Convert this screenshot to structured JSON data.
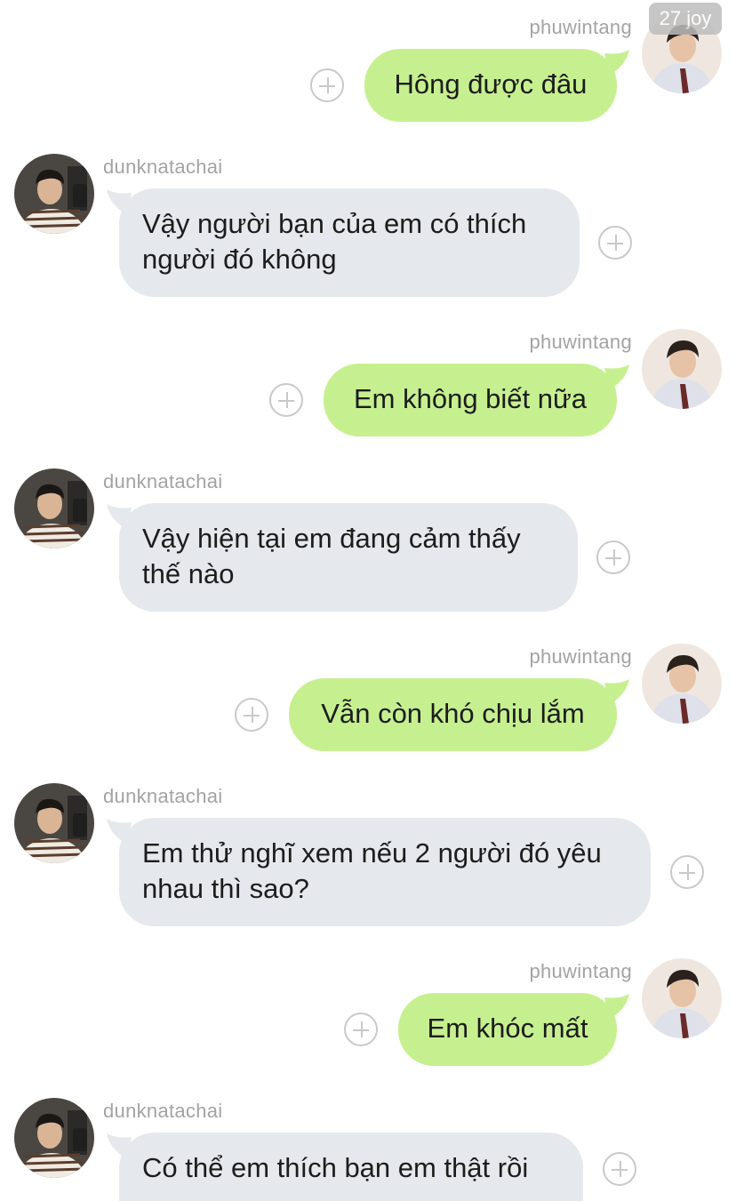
{
  "watermark": "27 joy",
  "messages": [
    {
      "sender": "phuwintang",
      "side": "out",
      "text": "Hông được đâu"
    },
    {
      "sender": "dunknatachai",
      "side": "in",
      "text": "Vậy người bạn của em có thích người đó không"
    },
    {
      "sender": "phuwintang",
      "side": "out",
      "text": "Em không biết nữa"
    },
    {
      "sender": "dunknatachai",
      "side": "in",
      "text": "Vậy hiện tại em đang cảm thấy thế nào"
    },
    {
      "sender": "phuwintang",
      "side": "out",
      "text": "Vẫn còn khó chịu lắm"
    },
    {
      "sender": "dunknatachai",
      "side": "in",
      "text": "Em thử nghĩ xem nếu 2 người đó yêu nhau thì sao?"
    },
    {
      "sender": "phuwintang",
      "side": "out",
      "text": "Em khóc mất"
    },
    {
      "sender": "dunknatachai",
      "side": "in",
      "text": "Có thể em thích bạn em thật rồi"
    }
  ],
  "colors": {
    "outgoing_bubble": "#c6f08f",
    "incoming_bubble": "#e5e8ec",
    "sender_name": "#a3a3a3",
    "add_icon": "#c9c9c9"
  }
}
